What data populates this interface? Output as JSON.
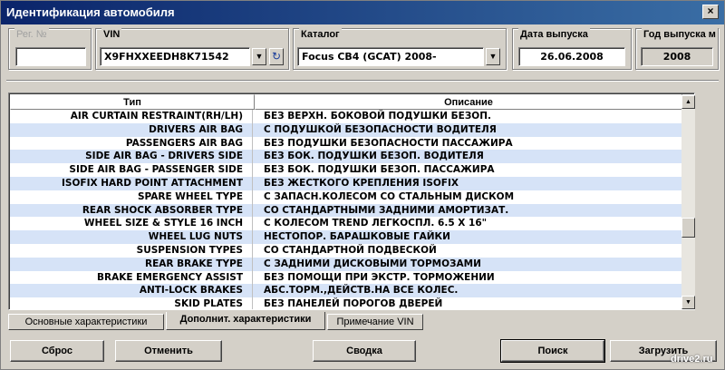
{
  "window": {
    "title": "Идентификация автомобиля",
    "close_glyph": "×"
  },
  "reg": {
    "label": "Рег. №",
    "value": ""
  },
  "vin": {
    "label": "VIN",
    "value": "X9FHXXEEDH8K71542"
  },
  "catalog": {
    "label": "Каталог",
    "value": "Focus CB4 (GCAT) 2008-"
  },
  "release_date": {
    "label": "Дата выпуска",
    "value": "26.06.2008"
  },
  "release_year": {
    "label": "Год выпуска м",
    "value": "2008"
  },
  "grid": {
    "headers": {
      "type": "Тип",
      "description": "Описание"
    },
    "rows": [
      {
        "type": "AIR CURTAIN RESTRAINT(RH/LH)",
        "description": "БЕЗ ВЕРХН. БОКОВОЙ ПОДУШКИ БЕЗОП."
      },
      {
        "type": "DRIVERS AIR BAG",
        "description": "С ПОДУШКОЙ БЕЗОПАСНОСТИ ВОДИТЕЛЯ"
      },
      {
        "type": "PASSENGERS AIR BAG",
        "description": "БЕЗ ПОДУШКИ БЕЗОПАСНОСТИ ПАССАЖИРА"
      },
      {
        "type": "SIDE AIR BAG - DRIVERS SIDE",
        "description": "БЕЗ БОК. ПОДУШКИ БЕЗОП. ВОДИТЕЛЯ"
      },
      {
        "type": "SIDE AIR BAG - PASSENGER SIDE",
        "description": "БЕЗ БОК. ПОДУШКИ БЕЗОП. ПАССАЖИРА"
      },
      {
        "type": "ISOFIX HARD POINT ATTACHMENT",
        "description": "БЕЗ ЖЕСТКОГО КРЕПЛЕНИЯ ISOFIX"
      },
      {
        "type": "SPARE WHEEL TYPE",
        "description": "С ЗАПАСН.КОЛЕСОМ СО СТАЛЬНЫМ ДИСКОМ"
      },
      {
        "type": "REAR SHOCK ABSORBER TYPE",
        "description": "СО СТАНДАРТНЫМИ ЗАДНИМИ АМОРТИЗАТ."
      },
      {
        "type": "WHEEL SIZE & STYLE 16 INCH",
        "description": "С КОЛЕСОМ TREND ЛЕГКОСПЛ. 6.5 X 16\""
      },
      {
        "type": "WHEEL LUG NUTS",
        "description": "НЕСТОПОР. БАРАШКОВЫЕ ГАЙКИ"
      },
      {
        "type": "SUSPENSION TYPES",
        "description": "СО СТАНДАРТНОЙ ПОДВЕСКОЙ"
      },
      {
        "type": "REAR BRAKE TYPE",
        "description": "С ЗАДНИМИ ДИСКОВЫМИ ТОРМОЗАМИ"
      },
      {
        "type": "BRAKE EMERGENCY ASSIST",
        "description": "БЕЗ ПОМОЩИ ПРИ ЭКСТР. ТОРМОЖЕНИИ"
      },
      {
        "type": "ANTI-LOCK BRAKES",
        "description": "АБС.ТОРМ.,ДЕЙСТВ.НА ВСЕ КОЛЕС."
      },
      {
        "type": "SKID PLATES",
        "description": "БЕЗ ПАНЕЛЕЙ ПОРОГОВ ДВЕРЕЙ"
      }
    ]
  },
  "tabs": [
    {
      "label": "Основные характеристики",
      "active": false
    },
    {
      "label": "Дополнит. характеристики",
      "active": true
    },
    {
      "label": "Примечание VIN",
      "active": false
    }
  ],
  "buttons": {
    "reset": "Сброс",
    "cancel": "Отменить",
    "summary": "Сводка",
    "search": "Поиск",
    "load": "Загрузить"
  },
  "icons": {
    "dropdown": "dropdown-arrow-icon",
    "refresh": "refresh-icon",
    "scroll_up": "▲",
    "scroll_down": "▼"
  },
  "watermark": "drive2.ru",
  "colors": {
    "title_start": "#0a246a",
    "title_end": "#3a6ea5",
    "row_alt": "#d6e3f7"
  }
}
